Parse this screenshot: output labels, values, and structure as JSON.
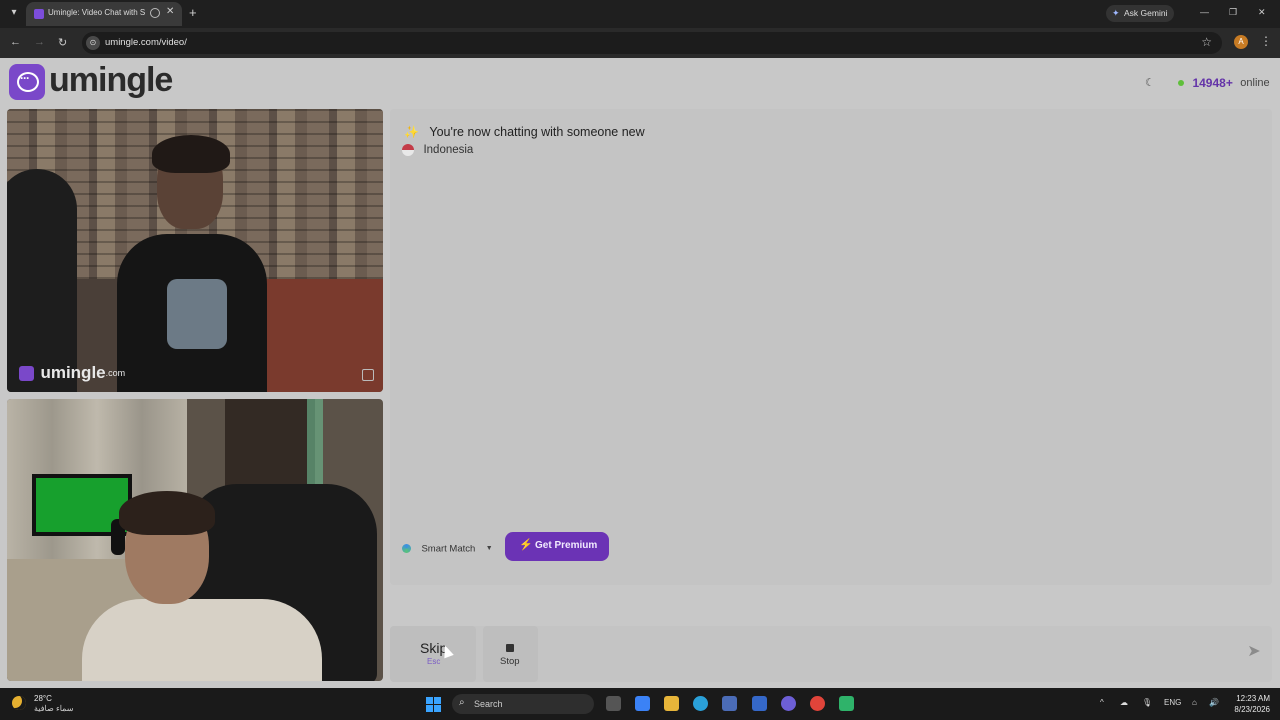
{
  "browser": {
    "tab_title": "Umingle: Video Chat with S",
    "url": "umingle.com/video/",
    "ask_gemini": "Ask Gemini",
    "profile_initial": "A"
  },
  "header": {
    "logo_text": "umingle",
    "online_count": "14948+",
    "online_label": "online"
  },
  "video": {
    "watermark_text": "umingle",
    "watermark_suffix": ".com"
  },
  "chat": {
    "status_text": "You're now chatting with someone new",
    "partner_country": "Indonesia",
    "message_placeholder": ""
  },
  "controls": {
    "smart_match_label": "Smart Match",
    "premium_label": "Get Premium",
    "skip_label": "Skip",
    "skip_hint": "Esc",
    "stop_label": "Stop"
  },
  "taskbar": {
    "temperature": "28°C",
    "weather_desc": "سماء صافية",
    "search_label": "Search",
    "language": "ENG",
    "time": "12:23 AM",
    "date": "8/23/2026"
  },
  "colors": {
    "brand_purple": "#7a48c9",
    "premium_bg": "#6b33b5",
    "online_green": "#5fbf3a",
    "online_count": "#6434a8"
  },
  "icons": [
    "tab-menu-icon",
    "tab-favicon-icon",
    "audio-icon",
    "close-icon",
    "new-tab-icon",
    "gemini-spark-icon",
    "back-icon",
    "forward-icon",
    "reload-icon",
    "site-info-icon",
    "bookmark-star-icon",
    "kebab-menu-icon",
    "moon-icon",
    "sparkle-icon",
    "flag-icon",
    "smart-match-icon",
    "caret-down-icon",
    "bolt-icon",
    "stop-icon",
    "send-icon",
    "report-icon",
    "windows-start-icon",
    "search-icon"
  ]
}
